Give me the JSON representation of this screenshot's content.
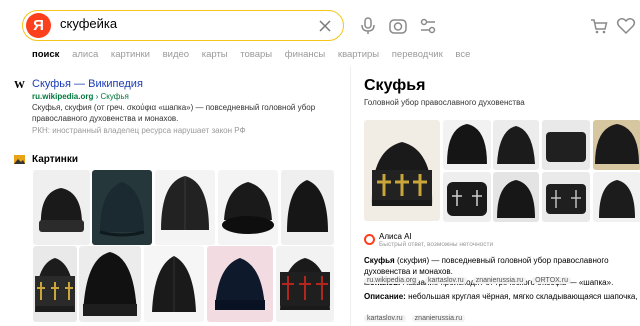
{
  "search": {
    "logo_letter": "Я",
    "query": "скуфейка"
  },
  "tabs": [
    "поиск",
    "алиса",
    "картинки",
    "видео",
    "карты",
    "товары",
    "финансы",
    "квартиры",
    "переводчик",
    "все"
  ],
  "wiki": {
    "icon": "W",
    "title": "Скуфья — Википедия",
    "url_host": "ru.wikipedia.org",
    "url_path": "› Скуфья",
    "snippet": "Скуфья, скуфия (от греч. σκούφια «шапка») — повседневный головной убор православного духовенства и монахов.",
    "warning": "РКН: иностранный владелец ресурса нарушает закон РФ"
  },
  "images_section": {
    "title": "Картинки",
    "icon": "images-icon"
  },
  "panel": {
    "title": "Скуфья",
    "subtitle": "Головной убор православного духовенства"
  },
  "alice": {
    "name": "Алиса AI",
    "note": "Быстрый ответ, возможны неточности",
    "answer_bold": "Скуфья",
    "answer_rest": " (скуфия) — повседневный головной убор православного духовенства и монахов.",
    "answer_line2_bold": "монахов.",
    "answer_line2_rest": " Название происходит от греческого σκούφια — «шапка».",
    "sources_1": [
      "ru.wikipedia.org",
      "kartaslov.ru",
      "znanierussia.ru",
      "ORTOX.ru"
    ],
    "desc_label": "Описание:",
    "desc_text": " небольшая круглая чёрная, мягко складывающаяся шапочка, складки которой образуют вокруг головы знамение креста.",
    "sources_2": [
      "kartaslov.ru",
      "znanierussia.ru"
    ]
  },
  "colors": {
    "brand_red": "#fc3f1d",
    "link_blue": "#1b3bb5",
    "url_green": "#007a3d",
    "search_border": "#f5c518"
  }
}
